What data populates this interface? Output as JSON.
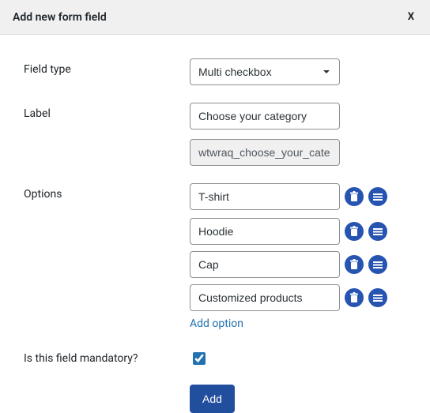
{
  "header": {
    "title": "Add new form field",
    "close": "X"
  },
  "labels": {
    "field_type": "Field type",
    "label": "Label",
    "options": "Options",
    "mandatory": "Is this field mandatory?"
  },
  "fields": {
    "field_type_value": "Multi checkbox",
    "label_value": "Choose your category",
    "slug_value": "wtwraq_choose_your_cate",
    "options": [
      "T-shirt",
      "Hoodie",
      "Cap",
      "Customized products"
    ],
    "add_option": "Add option",
    "mandatory_checked": true
  },
  "buttons": {
    "add": "Add"
  },
  "colors": {
    "accent": "#2654b0",
    "link": "#2271b1"
  }
}
